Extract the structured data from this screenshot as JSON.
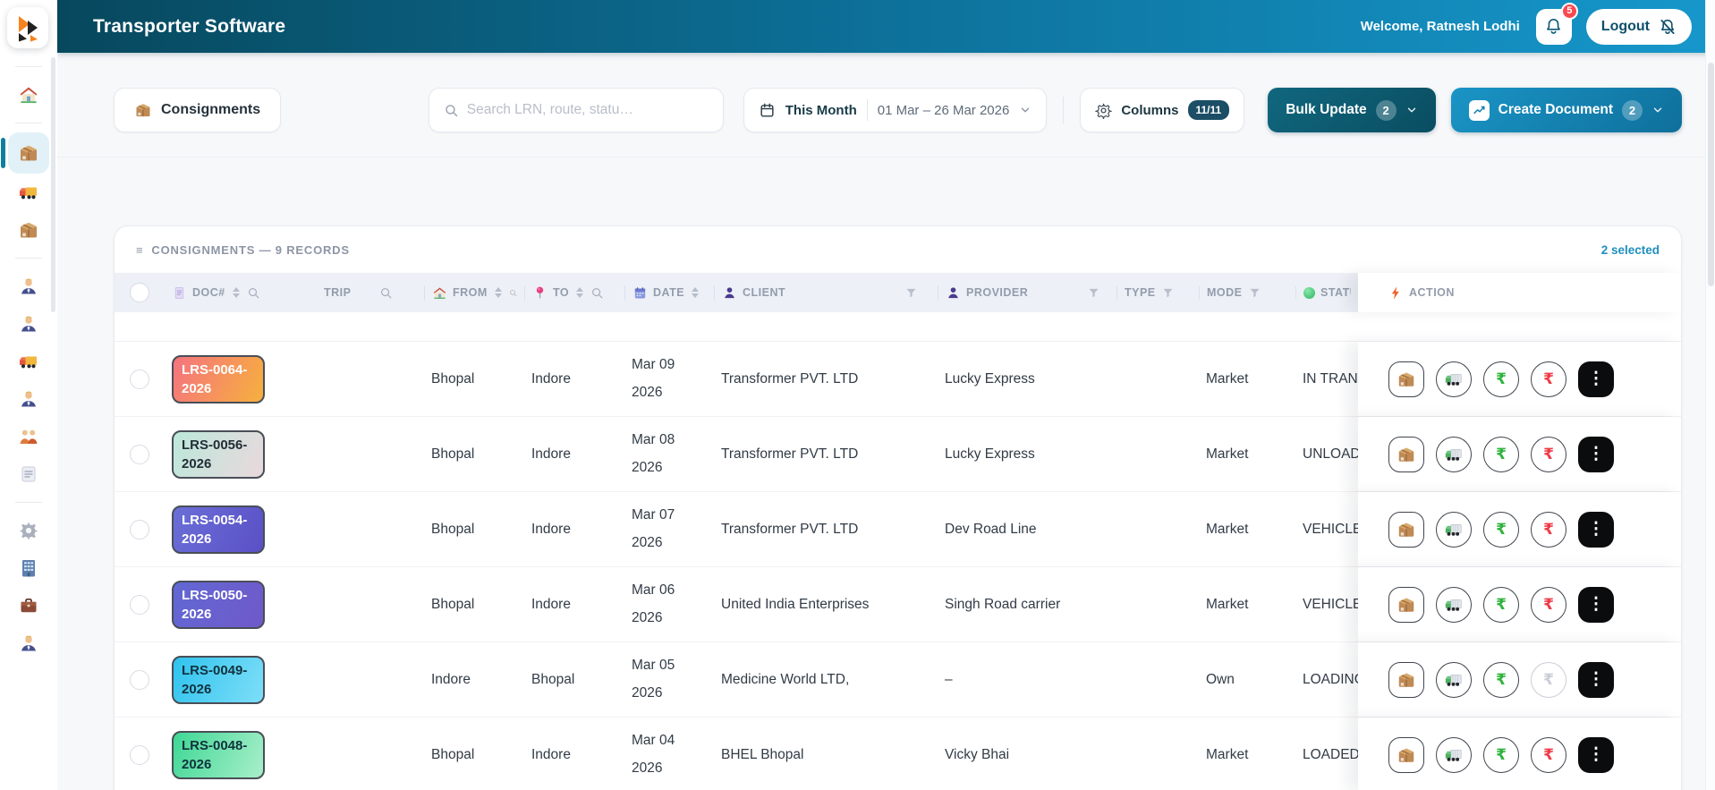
{
  "header": {
    "title": "Transporter Software",
    "welcome": "Welcome, Ratnesh Lodhi",
    "notifications_count": "5",
    "logout_label": "Logout"
  },
  "sidebar": {
    "active_index": 1,
    "items": [
      "home",
      "consignments-package",
      "delivery-truck",
      "package",
      "manager-person",
      "manager-person",
      "truck",
      "manager-person",
      "team",
      "document",
      "settings-gear",
      "company-building",
      "briefcase",
      "manager-person"
    ]
  },
  "toolbar": {
    "consignments_label": "Consignments",
    "search_placeholder": "Search LRN, route, statu…",
    "date_filter": {
      "label": "This Month",
      "range": "01 Mar – 26 Mar 2026"
    },
    "columns_label": "Columns",
    "columns_badge": "11/11",
    "bulk_update_label": "Bulk Update",
    "bulk_update_count": "2",
    "create_document_label": "Create Document",
    "create_document_count": "2"
  },
  "icons": {
    "menu": "≡",
    "kebab": "⋮",
    "rupee": "₹"
  },
  "colors": {
    "header_gradient_left": "#07485d",
    "header_gradient_right": "#1697cb",
    "accent_teal": "#0d7f9e",
    "selected_blue": "#1f8fbe",
    "badge_red": "#f9494e"
  },
  "table": {
    "title": "CONSIGNMENTS — 9 RECORDS",
    "selected_text": "2 selected",
    "columns": {
      "doc": "DOC#",
      "trip": "TRIP",
      "from": "FROM",
      "to": "TO",
      "date": "DATE",
      "client": "CLIENT",
      "provider": "PROVIDER",
      "type": "TYPE",
      "mode": "MODE",
      "status": "STATUS",
      "action": "ACTION"
    },
    "rows": [
      {
        "doc": "LRS-0064-2026",
        "badge": {
          "from": "#f5737f",
          "to": "#f6b03e",
          "text": "#ffffff"
        },
        "trip": "",
        "from": "Bhopal",
        "to": "Indore",
        "date": "Mar 09 2026",
        "client": "Transformer PVT. LTD",
        "provider": "Lucky Express",
        "type": "",
        "mode": "Market",
        "status": "IN TRANS",
        "rupee_red_disabled": false
      },
      {
        "doc": "LRS-0056-2026",
        "badge": {
          "from": "#bce8da",
          "to": "#e9d8dc",
          "text": "#232e38"
        },
        "trip": "",
        "from": "Bhopal",
        "to": "Indore",
        "date": "Mar 08 2026",
        "client": "Transformer PVT. LTD",
        "provider": "Lucky Express",
        "type": "",
        "mode": "Market",
        "status": "UNLOADE",
        "rupee_red_disabled": false
      },
      {
        "doc": "LRS-0054-2026",
        "badge": {
          "from": "#6b6fd7",
          "to": "#5a50c6",
          "text": "#ffffff"
        },
        "trip": "",
        "from": "Bhopal",
        "to": "Indore",
        "date": "Mar 07 2026",
        "client": "Transformer PVT. LTD",
        "provider": "Dev Road Line",
        "type": "",
        "mode": "Market",
        "status": "VEHICLE",
        "rupee_red_disabled": false
      },
      {
        "doc": "LRS-0050-2026",
        "badge": {
          "from": "#6168d4",
          "to": "#7059c9",
          "text": "#ffffff"
        },
        "trip": "",
        "from": "Bhopal",
        "to": "Indore",
        "date": "Mar 06 2026",
        "client": "United India Enterprises",
        "provider": "Singh Road carrier",
        "type": "",
        "mode": "Market",
        "status": "VEHICLE",
        "rupee_red_disabled": false
      },
      {
        "doc": "LRS-0049-2026",
        "badge": {
          "from": "#2fc3ee",
          "to": "#7edef8",
          "text": "#11323e"
        },
        "trip": "",
        "from": "Indore",
        "to": "Bhopal",
        "date": "Mar 05 2026",
        "client": "Medicine World LTD,",
        "provider": "–",
        "type": "",
        "mode": "Own",
        "status": "LOADING",
        "rupee_red_disabled": true
      },
      {
        "doc": "LRS-0048-2026",
        "badge": {
          "from": "#3fd795",
          "to": "#a8efc9",
          "text": "#11323e"
        },
        "trip": "",
        "from": "Bhopal",
        "to": "Indore",
        "date": "Mar 04 2026",
        "client": "BHEL Bhopal",
        "provider": "Vicky Bhai",
        "type": "",
        "mode": "Market",
        "status": "LOADED",
        "rupee_red_disabled": false
      }
    ]
  }
}
